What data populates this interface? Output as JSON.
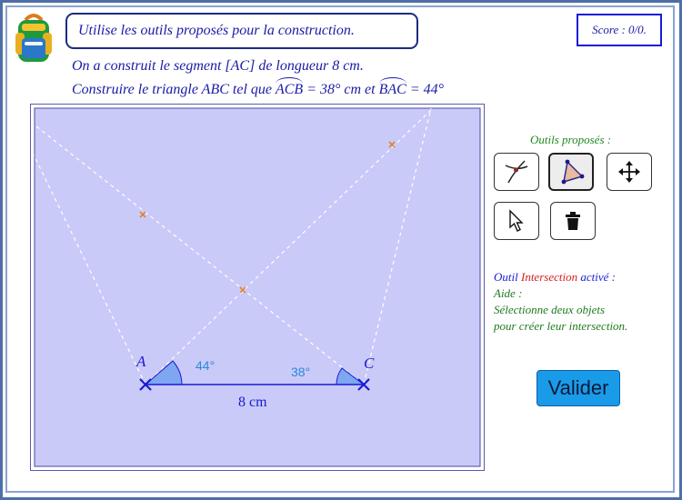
{
  "instruction": "Utilise les outils proposés pour la construction.",
  "score": "Score : 0/0.",
  "statement": {
    "line1": "On a construit le segment [AC] de longueur 8 cm.",
    "line2_prefix": "Construire le triangle ABC tel que ",
    "angle1_name": "ACB",
    "angle1_value": " = 38° cm et ",
    "angle2_name": "BAC",
    "angle2_value": " = 44°"
  },
  "figure": {
    "point_a": "A",
    "point_c": "C",
    "angle_a": "44°",
    "angle_c": "38°",
    "segment_length": "8 cm"
  },
  "tools": {
    "title": "Outils proposés :",
    "buttons": [
      {
        "name": "intersection-tool",
        "icon": "intersection-icon"
      },
      {
        "name": "polygon-tool",
        "icon": "polygon-icon"
      },
      {
        "name": "move-view-tool",
        "icon": "move-arrows-icon"
      },
      {
        "name": "select-tool",
        "icon": "cursor-icon"
      },
      {
        "name": "delete-tool",
        "icon": "trash-icon"
      }
    ]
  },
  "status": {
    "tool_prefix": "Outil ",
    "tool_name": "Intersection",
    "tool_suffix": " activé :",
    "help_label": "Aide :",
    "help_line1": "Sélectionne deux objets",
    "help_line2": "pour créer leur intersection."
  },
  "validate_label": "Valider",
  "colors": {
    "board_fill": "#c9caf7",
    "construction_lines": "#ffffff",
    "segment": "#1a1ad6",
    "angle_fill": "#7fa6f0",
    "angle_text": "#2a8ad6",
    "point_mark": "#e07a1a",
    "validate_button": "#1a9be8"
  }
}
